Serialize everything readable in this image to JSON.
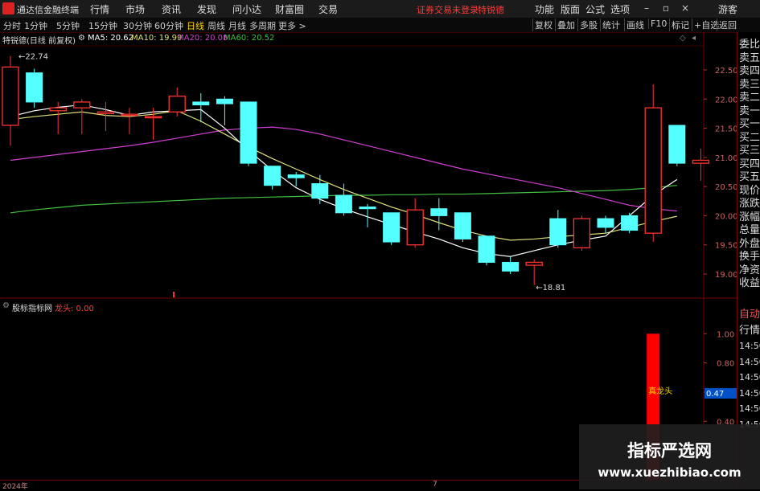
{
  "titlebar": {
    "app_name": "通达信金融终端",
    "menus": [
      "行情",
      "市场",
      "资讯",
      "发现",
      "问小达",
      "财富圈",
      "交易"
    ],
    "status": "证券交易未登录",
    "status2": "特锐德",
    "right_menus": [
      "功能",
      "版面",
      "公式",
      "选项"
    ],
    "guest": "游客"
  },
  "toolbar": {
    "timeframes": [
      "分时",
      "1分钟",
      "5分钟",
      "15分钟",
      "30分钟",
      "60分钟",
      "日线",
      "周线",
      "月线",
      "多周期",
      "更多 >"
    ],
    "active_index": 6,
    "right_tools": [
      "复权",
      "叠加",
      "多股",
      "统计",
      "画线",
      "F10",
      "标记",
      "+自选",
      "返回"
    ]
  },
  "info": {
    "stock": "特锐德(日线 前复权)",
    "ma5": "MA5: 20.62",
    "ma10": "MA10: 19.99",
    "ma20": "MA20: 20.08",
    "ma60": "MA60: 20.52"
  },
  "right_panel": [
    "委比",
    "卖五",
    "卖四",
    "卖三",
    "卖二",
    "卖一",
    "买一",
    "买二",
    "买三",
    "买四",
    "买五",
    "现价",
    "涨跌",
    "涨幅",
    "总量",
    "外盘",
    "换手",
    "净资",
    "收益"
  ],
  "right_panel2": [
    "自动",
    "行情",
    "14:50",
    "14:50",
    "14:50",
    "14:50",
    "14:50",
    "14:50"
  ],
  "sub": {
    "name": "股标指标网",
    "indicator": "龙头: 0.00",
    "signal_label": "真龙头",
    "axis_marker": "0.47"
  },
  "bottom": {
    "year": "2024年",
    "mark": "7"
  },
  "watermark": {
    "line1": "指标严选网",
    "line2": "www.xuezhibiao.com"
  },
  "colors": {
    "up": "#ff3232",
    "down": "#54ffff",
    "ma5": "#ffffff",
    "ma10": "#e0e07a",
    "ma20": "#d040d0",
    "ma60": "#40c040",
    "signal": "#ff0000"
  },
  "chart_data": {
    "type": "candlestick",
    "ylim": [
      18.6,
      22.9
    ],
    "yticks": [
      "22.50",
      "22.00",
      "21.50",
      "21.00",
      "20.50",
      "20.00",
      "19.50",
      "19.00"
    ],
    "ytick_values": [
      22.5,
      22.0,
      21.5,
      21.0,
      20.5,
      20.0,
      19.5,
      19.0
    ],
    "high_annotation": "22.74",
    "low_annotation": "18.81",
    "candles": [
      {
        "o": 21.55,
        "c": 22.55,
        "h": 22.74,
        "l": 21.2
      },
      {
        "o": 22.45,
        "c": 21.95,
        "h": 22.52,
        "l": 21.85
      },
      {
        "o": 21.8,
        "c": 21.85,
        "h": 21.95,
        "l": 21.4
      },
      {
        "o": 21.85,
        "c": 21.95,
        "h": 22.0,
        "l": 21.4
      },
      {
        "o": 21.75,
        "c": 21.78,
        "h": 21.95,
        "l": 21.45
      },
      {
        "o": 21.72,
        "c": 21.74,
        "h": 21.85,
        "l": 21.4
      },
      {
        "o": 21.68,
        "c": 21.7,
        "h": 21.85,
        "l": 21.3
      },
      {
        "o": 21.78,
        "c": 22.05,
        "h": 22.2,
        "l": 21.7
      },
      {
        "o": 21.95,
        "c": 21.9,
        "h": 22.1,
        "l": 21.6
      },
      {
        "o": 22.0,
        "c": 21.92,
        "h": 22.05,
        "l": 21.55
      },
      {
        "o": 21.95,
        "c": 20.9,
        "h": 21.95,
        "l": 20.85
      },
      {
        "o": 20.85,
        "c": 20.52,
        "h": 20.85,
        "l": 20.45
      },
      {
        "o": 20.7,
        "c": 20.65,
        "h": 20.75,
        "l": 20.5
      },
      {
        "o": 20.55,
        "c": 20.3,
        "h": 20.7,
        "l": 20.2
      },
      {
        "o": 20.35,
        "c": 20.05,
        "h": 20.55,
        "l": 20.0
      },
      {
        "o": 20.15,
        "c": 20.12,
        "h": 20.2,
        "l": 19.8
      },
      {
        "o": 20.05,
        "c": 19.55,
        "h": 20.05,
        "l": 19.5
      },
      {
        "o": 19.5,
        "c": 20.1,
        "h": 20.3,
        "l": 19.45
      },
      {
        "o": 20.12,
        "c": 20.0,
        "h": 20.3,
        "l": 19.75
      },
      {
        "o": 20.05,
        "c": 19.6,
        "h": 20.05,
        "l": 19.55
      },
      {
        "o": 19.65,
        "c": 19.2,
        "h": 19.65,
        "l": 19.15
      },
      {
        "o": 19.2,
        "c": 19.05,
        "h": 19.3,
        "l": 19.0
      },
      {
        "o": 19.15,
        "c": 19.2,
        "h": 19.25,
        "l": 18.81
      },
      {
        "o": 19.95,
        "c": 19.5,
        "h": 20.1,
        "l": 19.45
      },
      {
        "o": 19.45,
        "c": 19.95,
        "h": 20.0,
        "l": 19.4
      },
      {
        "o": 19.95,
        "c": 19.8,
        "h": 20.0,
        "l": 19.7
      },
      {
        "o": 20.0,
        "c": 19.75,
        "h": 20.05,
        "l": 19.7
      },
      {
        "o": 19.7,
        "c": 21.85,
        "h": 22.25,
        "l": 19.55
      },
      {
        "o": 21.55,
        "c": 20.9,
        "h": 21.55,
        "l": 20.85
      },
      {
        "o": 20.9,
        "c": 20.95,
        "h": 21.15,
        "l": 20.6
      }
    ],
    "ma5": [
      21.7,
      21.8,
      21.86,
      21.9,
      21.82,
      21.72,
      21.78,
      21.8,
      21.82,
      21.5,
      21.12,
      20.78,
      20.48,
      20.28,
      20.12,
      19.98,
      19.85,
      19.72,
      19.6,
      19.45,
      19.35,
      19.3,
      19.4,
      19.5,
      19.58,
      19.65,
      20.0,
      20.35,
      20.62
    ],
    "ma10": [
      21.65,
      21.7,
      21.74,
      21.78,
      21.72,
      21.7,
      21.74,
      21.8,
      21.62,
      21.4,
      21.18,
      20.98,
      20.8,
      20.62,
      20.45,
      20.3,
      20.15,
      20.02,
      19.88,
      19.75,
      19.65,
      19.58,
      19.6,
      19.64,
      19.67,
      19.7,
      19.8,
      19.9,
      19.99
    ],
    "ma20": [
      20.95,
      21.0,
      21.05,
      21.1,
      21.15,
      21.2,
      21.26,
      21.33,
      21.4,
      21.47,
      21.5,
      21.52,
      21.48,
      21.4,
      21.3,
      21.2,
      21.1,
      21.0,
      20.9,
      20.8,
      20.72,
      20.64,
      20.56,
      20.48,
      20.38,
      20.28,
      20.18,
      20.12,
      20.08
    ],
    "ma60": [
      20.05,
      20.1,
      20.14,
      20.18,
      20.2,
      20.22,
      20.24,
      20.26,
      20.28,
      20.3,
      20.31,
      20.32,
      20.33,
      20.34,
      20.35,
      20.35,
      20.36,
      20.36,
      20.37,
      20.37,
      20.38,
      20.39,
      20.4,
      20.41,
      20.42,
      20.43,
      20.45,
      20.48,
      20.52
    ],
    "sub_ylim": [
      0,
      1.15
    ],
    "sub_yticks": [
      "1.00",
      "0.80",
      "0.60",
      "0.40"
    ],
    "sub_ytick_values": [
      1.0,
      0.8,
      0.6,
      0.4
    ],
    "signal_index": 27,
    "signal_value": 1.0
  }
}
